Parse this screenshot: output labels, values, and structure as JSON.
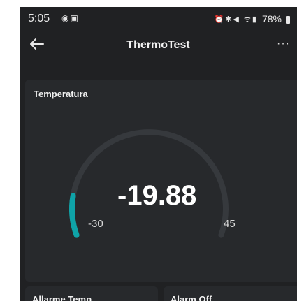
{
  "status_bar": {
    "time": "5:05",
    "left_icons": "notification-icons",
    "battery_percent": "78%"
  },
  "app_bar": {
    "title": "ThermoTest",
    "more": "···"
  },
  "gauge_card": {
    "title": "Temperatura",
    "value": "-19.88",
    "min": "-30",
    "max": "45",
    "value_fraction": 0.135,
    "accent_color": "#0fa3a8",
    "track_color": "#36393d"
  },
  "bottom_cards": [
    {
      "label": "Allarme Temp"
    },
    {
      "label": "Alarm Off"
    }
  ]
}
